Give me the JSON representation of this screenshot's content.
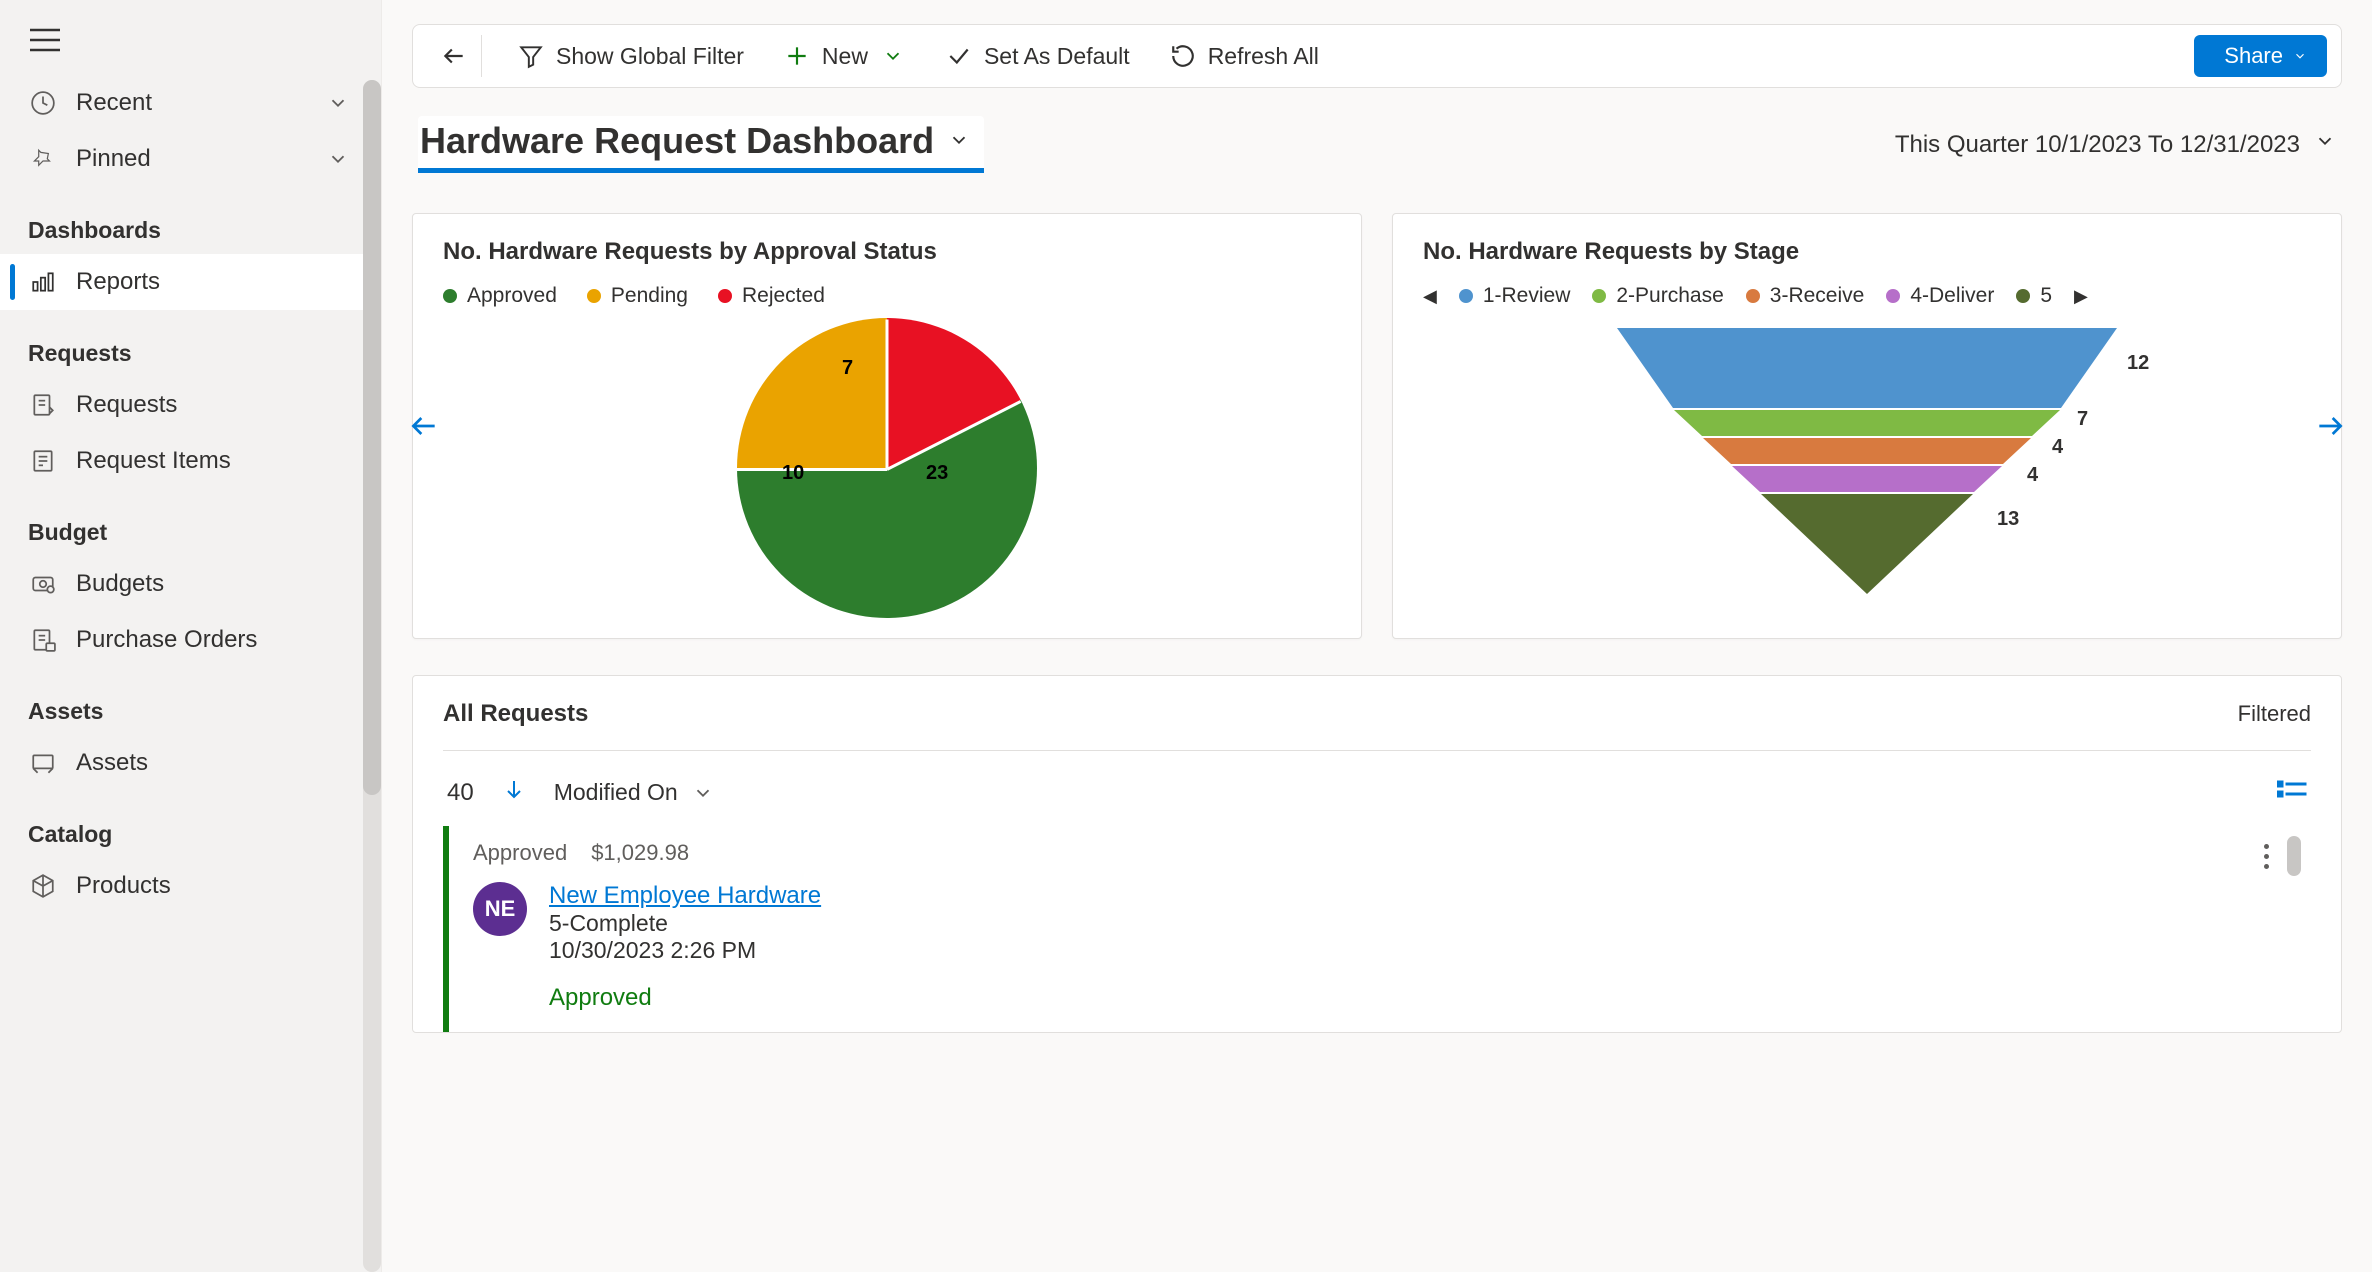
{
  "sidebar": {
    "recent": "Recent",
    "pinned": "Pinned",
    "sections": {
      "dashboards": "Dashboards",
      "requests": "Requests",
      "budget": "Budget",
      "assets": "Assets",
      "catalog": "Catalog"
    },
    "items": {
      "reports": "Reports",
      "requests": "Requests",
      "request_items": "Request Items",
      "budgets": "Budgets",
      "purchase_orders": "Purchase Orders",
      "assets": "Assets",
      "products": "Products"
    }
  },
  "toolbar": {
    "show_filter": "Show Global Filter",
    "new": "New",
    "set_default": "Set As Default",
    "refresh": "Refresh All",
    "share": "Share"
  },
  "title": "Hardware Request Dashboard",
  "date_range": "This Quarter 10/1/2023 To 12/31/2023",
  "chart_data": [
    {
      "type": "pie",
      "title": "No. Hardware Requests by Approval Status",
      "series": [
        {
          "name": "Approved",
          "value": 23,
          "color": "#2d7d2d"
        },
        {
          "name": "Pending",
          "value": 10,
          "color": "#eaa300"
        },
        {
          "name": "Rejected",
          "value": 7,
          "color": "#e81123"
        }
      ]
    },
    {
      "type": "funnel",
      "title": "No. Hardware Requests by Stage",
      "series": [
        {
          "name": "1-Review",
          "value": 12,
          "color": "#4f93ce"
        },
        {
          "name": "2-Purchase",
          "value": 7,
          "color": "#7fba44"
        },
        {
          "name": "3-Receive",
          "value": 4,
          "color": "#d87a3f"
        },
        {
          "name": "4-Deliver",
          "value": 4,
          "color": "#b66fc9"
        },
        {
          "name": "5-Complete",
          "value": 13,
          "color": "#556b2f"
        }
      ],
      "legend_overflow": "5"
    }
  ],
  "requests": {
    "heading": "All Requests",
    "filtered_label": "Filtered",
    "count": "40",
    "sort_by": "Modified On",
    "item": {
      "status_label": "Approved",
      "amount": "$1,029.98",
      "avatar_initials": "NE",
      "title": "New Employee Hardware",
      "stage": "5-Complete",
      "modified": "10/30/2023 2:26 PM",
      "approval": "Approved"
    }
  }
}
